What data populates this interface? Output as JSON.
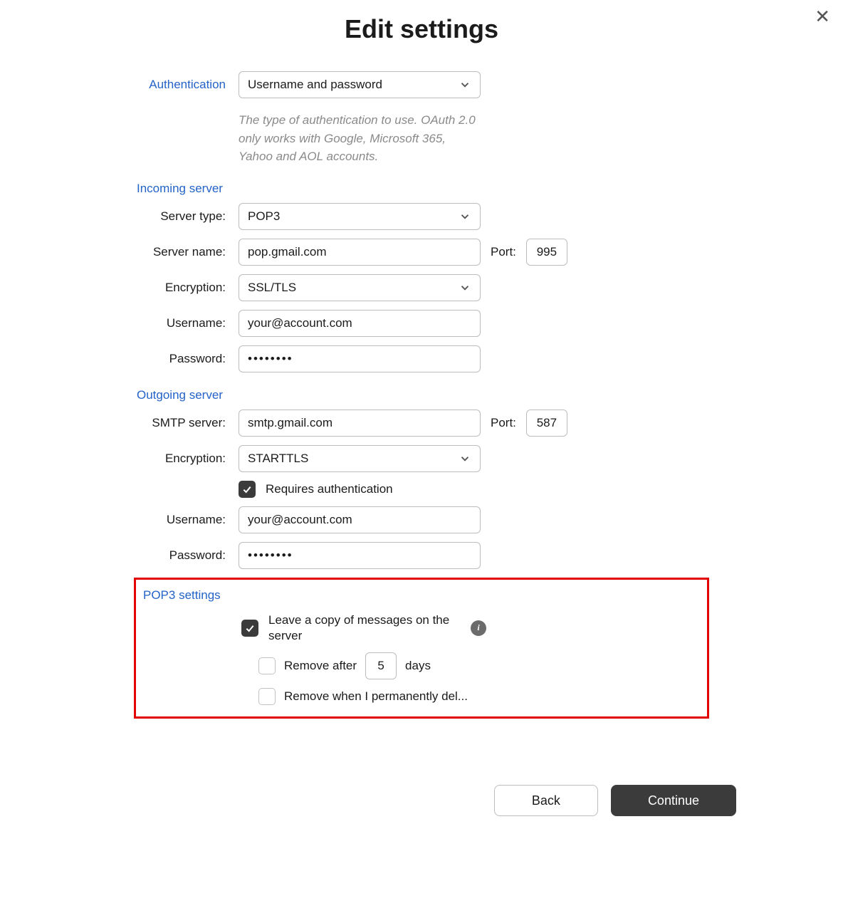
{
  "title": "Edit settings",
  "labels": {
    "authentication": "Authentication",
    "incoming_server": "Incoming server",
    "server_type": "Server type:",
    "server_name": "Server name:",
    "encryption": "Encryption:",
    "username": "Username:",
    "password": "Password:",
    "port": "Port:",
    "outgoing_server": "Outgoing server",
    "smtp_server": "SMTP server:",
    "requires_auth": "Requires authentication",
    "pop3_settings": "POP3 settings",
    "leave_copy": "Leave a copy of messages on the server",
    "remove_after_pre": "Remove after",
    "remove_after_post": "days",
    "remove_perm": "Remove when I permanently del...",
    "back": "Back",
    "continue": "Continue"
  },
  "auth": {
    "value": "Username and password",
    "help": "The type of authentication to use. OAuth 2.0 only works with Google, Microsoft 365, Yahoo and AOL accounts."
  },
  "incoming": {
    "server_type": "POP3",
    "server_name": "pop.gmail.com",
    "port": "995",
    "encryption": "SSL/TLS",
    "username": "your@account.com",
    "password": "••••••••"
  },
  "outgoing": {
    "smtp_server": "smtp.gmail.com",
    "port": "587",
    "encryption": "STARTTLS",
    "requires_auth": true,
    "username": "your@account.com",
    "password": "••••••••"
  },
  "pop3": {
    "leave_copy": true,
    "remove_after_enabled": false,
    "remove_after_days": "5",
    "remove_perm_enabled": false
  }
}
